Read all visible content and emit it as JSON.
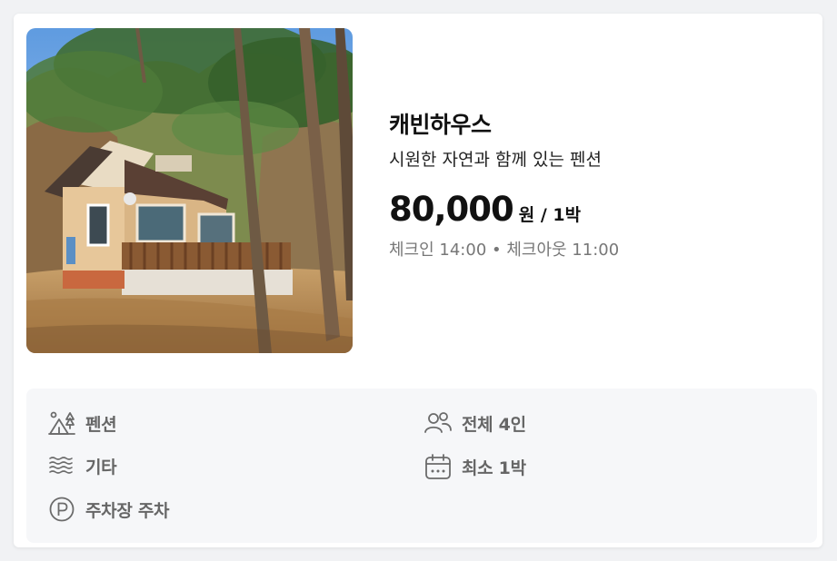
{
  "listing": {
    "title": "캐빈하우스",
    "subtitle": "시원한 자연과 함께 있는 펜션",
    "price": "80,000",
    "price_unit": "원 / 1박",
    "checkin_info": "체크인 14:00 • 체크아웃 11:00"
  },
  "features": [
    {
      "icon": "camping-icon",
      "label": "펜션"
    },
    {
      "icon": "people-icon",
      "label": "전체 4인"
    },
    {
      "icon": "waves-icon",
      "label": "기타"
    },
    {
      "icon": "calendar-icon",
      "label": "최소 1박"
    },
    {
      "icon": "parking-icon",
      "label": "주차장 주차"
    }
  ],
  "colors": {
    "text_primary": "#111111",
    "text_secondary": "#777777",
    "feature_text": "#666666",
    "feature_panel_bg": "#f6f7f9",
    "page_bg": "#f1f2f4"
  }
}
